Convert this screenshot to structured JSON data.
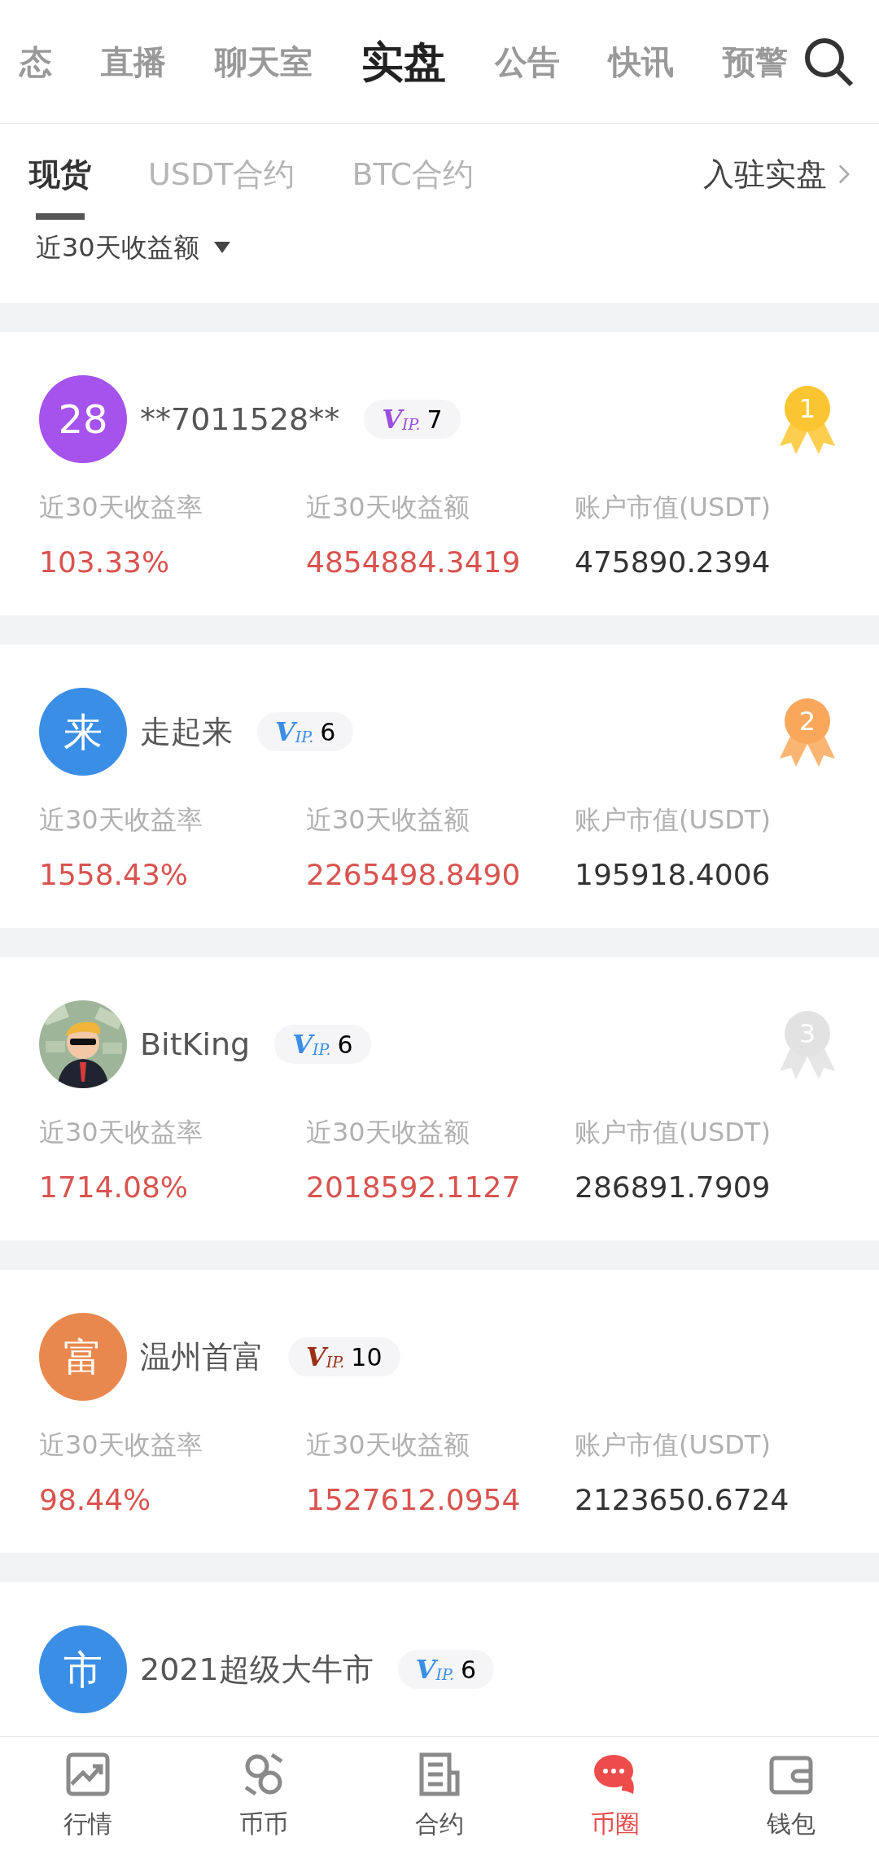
{
  "top_tabs": [
    {
      "label": "态",
      "selected": false
    },
    {
      "label": "直播",
      "selected": false
    },
    {
      "label": "聊天室",
      "selected": false
    },
    {
      "label": "实盘",
      "selected": true
    },
    {
      "label": "公告",
      "selected": false
    },
    {
      "label": "快讯",
      "selected": false
    },
    {
      "label": "预警",
      "selected": false
    }
  ],
  "sub_tabs": [
    {
      "label": "现货",
      "selected": true
    },
    {
      "label": "USDT合约",
      "selected": false
    },
    {
      "label": "BTC合约",
      "selected": false
    }
  ],
  "join_link": "入驻实盘",
  "sort": {
    "label": "近30天收益额"
  },
  "traders": [
    {
      "avatar": {
        "kind": "initial",
        "text": "28",
        "color": "#a652ec"
      },
      "name": "**7011528**",
      "vip": {
        "v": "V",
        "ip": "IP.",
        "tier": "7",
        "color": "#9b4ee0"
      },
      "rank": {
        "text": "1",
        "color": "#fbc531"
      },
      "stats": [
        {
          "label": "近30天收益率",
          "value": "103.33%",
          "kind": "gain"
        },
        {
          "label": "近30天收益额",
          "value": "4854884.3419",
          "kind": "gain"
        },
        {
          "label": "账户市值(USDT)",
          "value": "475890.2394",
          "kind": "plain"
        }
      ]
    },
    {
      "avatar": {
        "kind": "initial",
        "text": "来",
        "color": "#3a8ee6"
      },
      "name": "走起来",
      "vip": {
        "v": "V",
        "ip": "IP.",
        "tier": "6",
        "color": "#3a8ee6"
      },
      "rank": {
        "text": "2",
        "color": "#f9a85b"
      },
      "stats": [
        {
          "label": "近30天收益率",
          "value": "1558.43%",
          "kind": "gain"
        },
        {
          "label": "近30天收益额",
          "value": "2265498.8490",
          "kind": "gain"
        },
        {
          "label": "账户市值(USDT)",
          "value": "195918.4006",
          "kind": "plain"
        }
      ]
    },
    {
      "name": "BitKing",
      "vip": {
        "v": "V",
        "ip": "IP.",
        "tier": "6",
        "color": "#3a8ee6"
      },
      "rank": {
        "text": "3",
        "color": "#e2e2e2"
      },
      "stats": [
        {
          "label": "近30天收益率",
          "value": "1714.08%",
          "kind": "gain"
        },
        {
          "label": "近30天收益额",
          "value": "2018592.1127",
          "kind": "gain"
        },
        {
          "label": "账户市值(USDT)",
          "value": "286891.7909",
          "kind": "plain"
        }
      ]
    },
    {
      "avatar": {
        "kind": "initial",
        "text": "富",
        "color": "#e9884e"
      },
      "name": "温州首富",
      "vip": {
        "v": "V",
        "ip": "IP.",
        "tier": "10",
        "color": "#9c2f17"
      },
      "stats": [
        {
          "label": "近30天收益率",
          "value": "98.44%",
          "kind": "gain"
        },
        {
          "label": "近30天收益额",
          "value": "1527612.0954",
          "kind": "gain"
        },
        {
          "label": "账户市值(USDT)",
          "value": "2123650.6724",
          "kind": "plain"
        }
      ]
    },
    {
      "avatar": {
        "kind": "initial",
        "text": "市",
        "color": "#3a8ee6"
      },
      "name": "2021超级大牛市",
      "vip": {
        "v": "V",
        "ip": "IP.",
        "tier": "6",
        "color": "#3a8ee6"
      }
    }
  ],
  "bottom_nav": [
    {
      "label": "行情",
      "kind": "chart",
      "selected": false
    },
    {
      "label": "币币",
      "kind": "exchange",
      "selected": false
    },
    {
      "label": "合约",
      "kind": "document",
      "selected": false
    },
    {
      "label": "币圈",
      "kind": "chat",
      "selected": true
    },
    {
      "label": "钱包",
      "kind": "wallet",
      "selected": false
    }
  ]
}
